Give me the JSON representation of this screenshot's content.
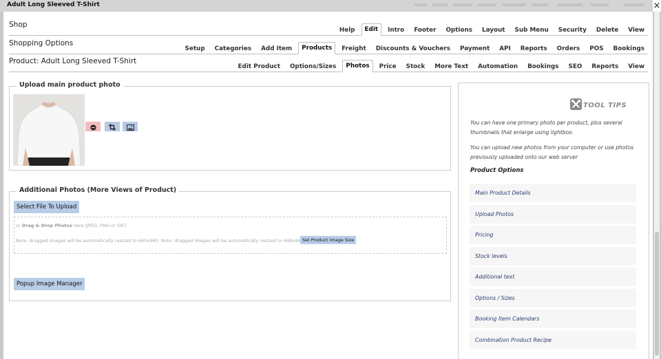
{
  "window": {
    "title": "Adult Long Sleeved T-Shirt",
    "close_label": "×"
  },
  "rows": [
    {
      "title": "Shop",
      "tabs": [
        "Help",
        "Edit",
        "Intro",
        "Footer",
        "Options",
        "Layout",
        "Sub Menu",
        "Security",
        "Delete",
        "View"
      ],
      "active": "Edit"
    },
    {
      "title": "Shopping Options",
      "tabs": [
        "Setup",
        "Categories",
        "Add Item",
        "Products",
        "Freight",
        "Discounts & Vouchers",
        "Payment",
        "API",
        "Reports",
        "Orders",
        "POS",
        "Bookings"
      ],
      "active": "Products"
    },
    {
      "title": "Product: Adult Long Sleeved T-Shirt",
      "tabs": [
        "Edit Product",
        "Options/Sizes",
        "Photos",
        "Price",
        "Stock",
        "More Text",
        "Automation",
        "Bookings",
        "SEO",
        "Reports",
        "View"
      ],
      "active": "Photos"
    }
  ],
  "upload_main": {
    "legend": "Upload main product photo",
    "buttons": [
      {
        "icon": "minus-icon",
        "color": "#f3bcbc"
      },
      {
        "icon": "crop-icon",
        "color": "#b7c9e6"
      },
      {
        "icon": "image-icon",
        "color": "#b7c9e6"
      }
    ]
  },
  "additional": {
    "legend": "Additional Photos (More Views of Product)",
    "select_file_label": "Select File To Upload",
    "drop_prefix": "or",
    "drop_bold": "Drag & Drop Photos",
    "drop_suffix": "here (JPEG, PNG or GIF)",
    "note": "Note: dragged images will be automatically resized to 640x960. Note: dragged images will be automatically resized to 448x448.",
    "set_size_label": "Set Product Image Size",
    "popup_label": "Popup Image Manager"
  },
  "tooltips": {
    "logo_text": "TOOL TIPS",
    "text1": "You can have one primary photo per product, plus several thumbnails that enlarge using lightbox.",
    "text2": "You can upload new photos from your computer or use photos previously uploaded onto our web server",
    "heading": "Product Options",
    "items": [
      "Main Product Details",
      "Upload Photos",
      "Pricing",
      "Stock levels",
      "Additional text",
      "Options / Sizes",
      "Booking Item Calendars",
      "Combination Product Recipe"
    ]
  },
  "colors": {
    "button_blue": "#b9cce8",
    "button_red": "#f3bcbc",
    "link_text": "#2b3a70"
  }
}
